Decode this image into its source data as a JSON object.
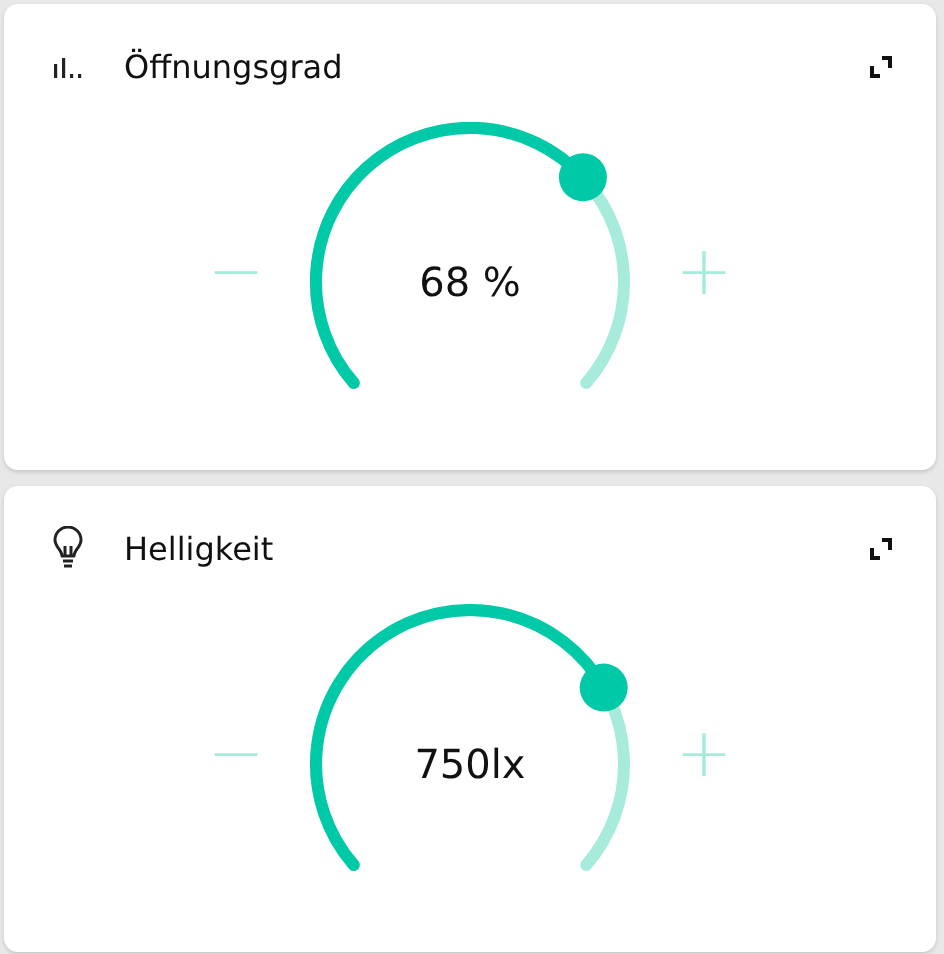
{
  "cards": [
    {
      "kind": "bars",
      "title": "Öffnungsgrad",
      "value": "68 %",
      "minus": "−",
      "plus": "+"
    },
    {
      "kind": "bulb",
      "title": "Helligkeit",
      "value": "750lx",
      "minus": "−",
      "plus": "+"
    }
  ]
}
